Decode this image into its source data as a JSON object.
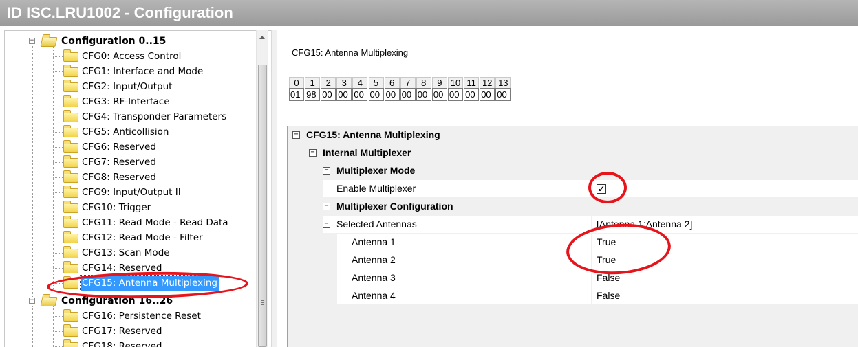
{
  "window": {
    "title": "ID ISC.LRU1002 - Configuration"
  },
  "tree": {
    "group1": {
      "label": "Configuration 0..15"
    },
    "group2": {
      "label": "Configuration 16..26"
    },
    "items": [
      {
        "label": "CFG0: Access Control"
      },
      {
        "label": "CFG1: Interface and Mode"
      },
      {
        "label": "CFG2: Input/Output"
      },
      {
        "label": "CFG3: RF-Interface"
      },
      {
        "label": "CFG4: Transponder Parameters"
      },
      {
        "label": "CFG5: Anticollision"
      },
      {
        "label": "CFG6: Reserved"
      },
      {
        "label": "CFG7: Reserved"
      },
      {
        "label": "CFG8: Reserved"
      },
      {
        "label": "CFG9: Input/Output II"
      },
      {
        "label": "CFG10: Trigger"
      },
      {
        "label": "CFG11: Read Mode - Read Data"
      },
      {
        "label": "CFG12: Read Mode - Filter"
      },
      {
        "label": "CFG13: Scan Mode"
      },
      {
        "label": "CFG14: Reserved"
      },
      {
        "label": "CFG15: Antenna Multiplexing"
      }
    ],
    "items2": [
      {
        "label": "CFG16: Persistence Reset"
      },
      {
        "label": "CFG17: Reserved"
      },
      {
        "label": "CFG18: Reserved"
      }
    ]
  },
  "panel": {
    "title": "CFG15: Antenna Multiplexing",
    "bytes": {
      "indexes": [
        "0",
        "1",
        "2",
        "3",
        "4",
        "5",
        "6",
        "7",
        "8",
        "9",
        "10",
        "11",
        "12",
        "13"
      ],
      "values": [
        "01",
        "98",
        "00",
        "00",
        "00",
        "00",
        "00",
        "00",
        "00",
        "00",
        "00",
        "00",
        "00",
        "00"
      ]
    },
    "grid": {
      "cat_main": "CFG15: Antenna Multiplexing",
      "cat_internal": "Internal Multiplexer",
      "cat_mode": "Multiplexer Mode",
      "enable_label": "Enable Multiplexer",
      "enable_checked": true,
      "enable_mark": "✓",
      "cat_config": "Multiplexer Configuration",
      "selected_label": "Selected Antennas",
      "selected_value": "[Antenna 1;Antenna 2]",
      "antennas": [
        {
          "label": "Antenna 1",
          "value": "True"
        },
        {
          "label": "Antenna 2",
          "value": "True"
        },
        {
          "label": "Antenna 3",
          "value": "False"
        },
        {
          "label": "Antenna 4",
          "value": "False"
        }
      ]
    }
  },
  "colors": {
    "annotation": "#e8141b",
    "selection": "#3399ff"
  }
}
